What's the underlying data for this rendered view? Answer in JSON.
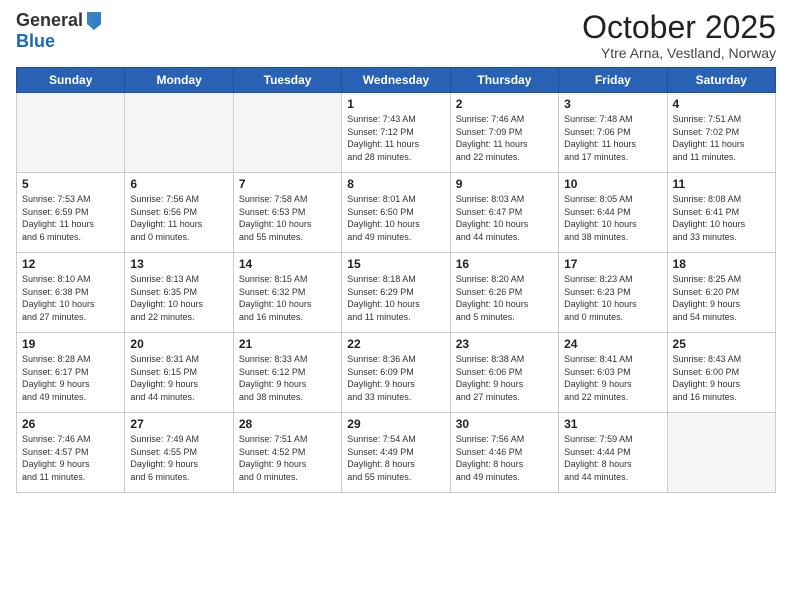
{
  "header": {
    "logo_general": "General",
    "logo_blue": "Blue",
    "month_title": "October 2025",
    "location": "Ytre Arna, Vestland, Norway"
  },
  "weekdays": [
    "Sunday",
    "Monday",
    "Tuesday",
    "Wednesday",
    "Thursday",
    "Friday",
    "Saturday"
  ],
  "rows": [
    [
      {
        "day": "",
        "text": ""
      },
      {
        "day": "",
        "text": ""
      },
      {
        "day": "",
        "text": ""
      },
      {
        "day": "1",
        "text": "Sunrise: 7:43 AM\nSunset: 7:12 PM\nDaylight: 11 hours\nand 28 minutes."
      },
      {
        "day": "2",
        "text": "Sunrise: 7:46 AM\nSunset: 7:09 PM\nDaylight: 11 hours\nand 22 minutes."
      },
      {
        "day": "3",
        "text": "Sunrise: 7:48 AM\nSunset: 7:06 PM\nDaylight: 11 hours\nand 17 minutes."
      },
      {
        "day": "4",
        "text": "Sunrise: 7:51 AM\nSunset: 7:02 PM\nDaylight: 11 hours\nand 11 minutes."
      }
    ],
    [
      {
        "day": "5",
        "text": "Sunrise: 7:53 AM\nSunset: 6:59 PM\nDaylight: 11 hours\nand 6 minutes."
      },
      {
        "day": "6",
        "text": "Sunrise: 7:56 AM\nSunset: 6:56 PM\nDaylight: 11 hours\nand 0 minutes."
      },
      {
        "day": "7",
        "text": "Sunrise: 7:58 AM\nSunset: 6:53 PM\nDaylight: 10 hours\nand 55 minutes."
      },
      {
        "day": "8",
        "text": "Sunrise: 8:01 AM\nSunset: 6:50 PM\nDaylight: 10 hours\nand 49 minutes."
      },
      {
        "day": "9",
        "text": "Sunrise: 8:03 AM\nSunset: 6:47 PM\nDaylight: 10 hours\nand 44 minutes."
      },
      {
        "day": "10",
        "text": "Sunrise: 8:05 AM\nSunset: 6:44 PM\nDaylight: 10 hours\nand 38 minutes."
      },
      {
        "day": "11",
        "text": "Sunrise: 8:08 AM\nSunset: 6:41 PM\nDaylight: 10 hours\nand 33 minutes."
      }
    ],
    [
      {
        "day": "12",
        "text": "Sunrise: 8:10 AM\nSunset: 6:38 PM\nDaylight: 10 hours\nand 27 minutes."
      },
      {
        "day": "13",
        "text": "Sunrise: 8:13 AM\nSunset: 6:35 PM\nDaylight: 10 hours\nand 22 minutes."
      },
      {
        "day": "14",
        "text": "Sunrise: 8:15 AM\nSunset: 6:32 PM\nDaylight: 10 hours\nand 16 minutes."
      },
      {
        "day": "15",
        "text": "Sunrise: 8:18 AM\nSunset: 6:29 PM\nDaylight: 10 hours\nand 11 minutes."
      },
      {
        "day": "16",
        "text": "Sunrise: 8:20 AM\nSunset: 6:26 PM\nDaylight: 10 hours\nand 5 minutes."
      },
      {
        "day": "17",
        "text": "Sunrise: 8:23 AM\nSunset: 6:23 PM\nDaylight: 10 hours\nand 0 minutes."
      },
      {
        "day": "18",
        "text": "Sunrise: 8:25 AM\nSunset: 6:20 PM\nDaylight: 9 hours\nand 54 minutes."
      }
    ],
    [
      {
        "day": "19",
        "text": "Sunrise: 8:28 AM\nSunset: 6:17 PM\nDaylight: 9 hours\nand 49 minutes."
      },
      {
        "day": "20",
        "text": "Sunrise: 8:31 AM\nSunset: 6:15 PM\nDaylight: 9 hours\nand 44 minutes."
      },
      {
        "day": "21",
        "text": "Sunrise: 8:33 AM\nSunset: 6:12 PM\nDaylight: 9 hours\nand 38 minutes."
      },
      {
        "day": "22",
        "text": "Sunrise: 8:36 AM\nSunset: 6:09 PM\nDaylight: 9 hours\nand 33 minutes."
      },
      {
        "day": "23",
        "text": "Sunrise: 8:38 AM\nSunset: 6:06 PM\nDaylight: 9 hours\nand 27 minutes."
      },
      {
        "day": "24",
        "text": "Sunrise: 8:41 AM\nSunset: 6:03 PM\nDaylight: 9 hours\nand 22 minutes."
      },
      {
        "day": "25",
        "text": "Sunrise: 8:43 AM\nSunset: 6:00 PM\nDaylight: 9 hours\nand 16 minutes."
      }
    ],
    [
      {
        "day": "26",
        "text": "Sunrise: 7:46 AM\nSunset: 4:57 PM\nDaylight: 9 hours\nand 11 minutes."
      },
      {
        "day": "27",
        "text": "Sunrise: 7:49 AM\nSunset: 4:55 PM\nDaylight: 9 hours\nand 6 minutes."
      },
      {
        "day": "28",
        "text": "Sunrise: 7:51 AM\nSunset: 4:52 PM\nDaylight: 9 hours\nand 0 minutes."
      },
      {
        "day": "29",
        "text": "Sunrise: 7:54 AM\nSunset: 4:49 PM\nDaylight: 8 hours\nand 55 minutes."
      },
      {
        "day": "30",
        "text": "Sunrise: 7:56 AM\nSunset: 4:46 PM\nDaylight: 8 hours\nand 49 minutes."
      },
      {
        "day": "31",
        "text": "Sunrise: 7:59 AM\nSunset: 4:44 PM\nDaylight: 8 hours\nand 44 minutes."
      },
      {
        "day": "",
        "text": ""
      }
    ]
  ]
}
